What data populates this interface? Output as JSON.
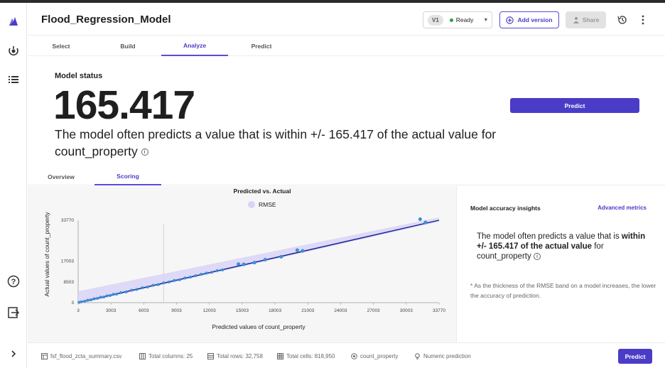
{
  "app": {
    "title": "Flood_Regression_Model"
  },
  "header": {
    "version_label": "V1",
    "status_text": "Ready",
    "add_version_label": "Add version",
    "share_label": "Share"
  },
  "tabs": [
    {
      "label": "Select"
    },
    {
      "label": "Build"
    },
    {
      "label": "Analyze"
    },
    {
      "label": "Predict"
    }
  ],
  "active_tab": "Analyze",
  "status": {
    "label": "Model status",
    "value": "165.417",
    "description": "The model often predicts a value that is within +/- 165.417 of the actual value for count_property",
    "predict_label": "Predict"
  },
  "subtabs": [
    {
      "label": "Overview"
    },
    {
      "label": "Scoring"
    }
  ],
  "active_subtab": "Scoring",
  "insights": {
    "title": "Model accuracy insights",
    "link": "Advanced metrics",
    "text_pre": "The model often predicts a value that is ",
    "text_bold": "within +/- 165.417 of the actual value",
    "text_post": " for count_property",
    "note": "* As the thickness of the RMSE band on a model increases, the lower the accuracy of prediction."
  },
  "footer": {
    "file": "fsf_flood_zcta_summary.csv",
    "columns": "Total columns: 25",
    "rows": "Total rows: 32,758",
    "cells": "Total cells: 818,950",
    "target": "count_property",
    "type": "Numeric prediction",
    "predict_label": "Predict"
  },
  "colors": {
    "accent": "#4b3cc7",
    "line": "#0d1f8c",
    "points": "#3a93d8",
    "band": "#d9d4f7"
  },
  "chart_data": {
    "type": "scatter",
    "title": "Predicted vs. Actual",
    "legend": [
      "RMSE"
    ],
    "xlabel": "Predicted values of count_property",
    "ylabel": "Actual values of count_property",
    "xlim": [
      3,
      33770
    ],
    "ylim": [
      3,
      33770
    ],
    "x_ticks": [
      "3",
      "3003",
      "6003",
      "9003",
      "12003",
      "15003",
      "18003",
      "21003",
      "24003",
      "27003",
      "30003",
      "33770"
    ],
    "y_ticks": [
      "3",
      "8503",
      "17003",
      "33770"
    ],
    "fit_line": [
      [
        3,
        3
      ],
      [
        33770,
        33770
      ]
    ],
    "points": [
      [
        80,
        120
      ],
      [
        300,
        350
      ],
      [
        600,
        550
      ],
      [
        900,
        1000
      ],
      [
        1200,
        1150
      ],
      [
        1500,
        1600
      ],
      [
        1800,
        1750
      ],
      [
        2100,
        2200
      ],
      [
        2400,
        2300
      ],
      [
        2700,
        2800
      ],
      [
        3000,
        2950
      ],
      [
        3300,
        3400
      ],
      [
        3600,
        3500
      ],
      [
        4000,
        4100
      ],
      [
        4500,
        4400
      ],
      [
        5000,
        5100
      ],
      [
        5500,
        5450
      ],
      [
        6000,
        6100
      ],
      [
        6500,
        6400
      ],
      [
        7000,
        7100
      ],
      [
        7500,
        7400
      ],
      [
        8000,
        8100
      ],
      [
        8500,
        8450
      ],
      [
        9000,
        9100
      ],
      [
        9500,
        9400
      ],
      [
        10000,
        10100
      ],
      [
        10500,
        10450
      ],
      [
        11000,
        11050
      ],
      [
        11500,
        11600
      ],
      [
        12000,
        12100
      ],
      [
        12500,
        12450
      ],
      [
        13000,
        13100
      ],
      [
        13500,
        13400
      ],
      [
        15000,
        15800
      ],
      [
        15500,
        15700
      ],
      [
        16500,
        16400
      ],
      [
        17500,
        17600
      ],
      [
        19000,
        18800
      ],
      [
        20500,
        21500
      ],
      [
        21000,
        21200
      ],
      [
        32000,
        34200
      ],
      [
        32500,
        32900
      ]
    ]
  }
}
